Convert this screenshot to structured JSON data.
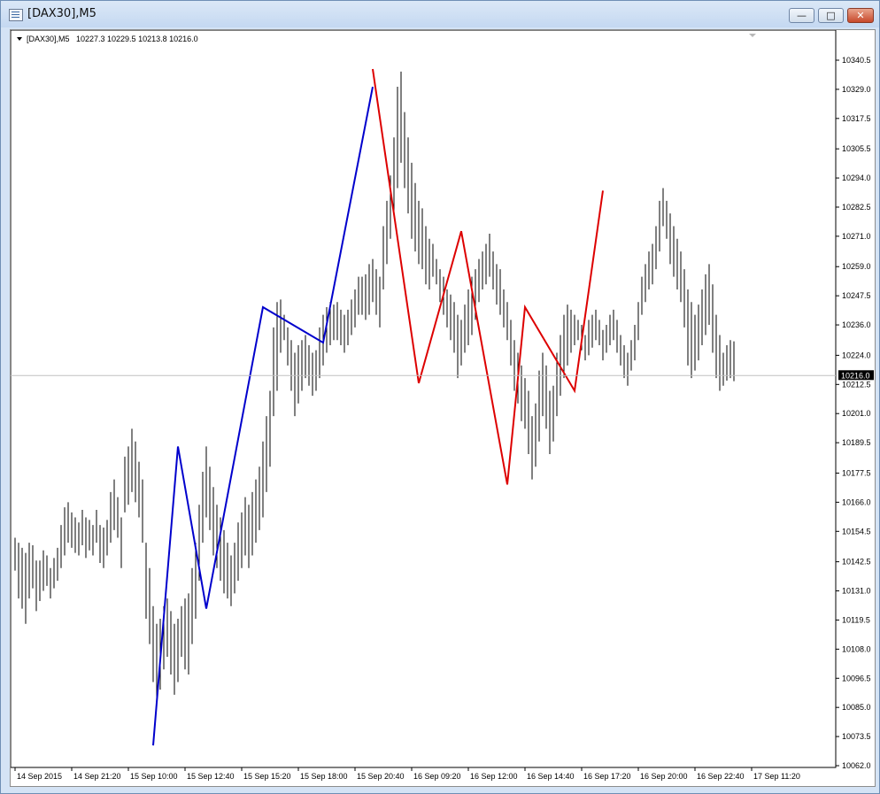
{
  "window": {
    "title": "[DAX30],M5",
    "buttons": {
      "minimize": "—",
      "maximize": "□",
      "close": "✕"
    },
    "icon": "chart-window-icon"
  },
  "chart_data": {
    "type": "bar",
    "symbol_header": "[DAX30],M5",
    "ohlc_header": "10227.3 10229.5 10213.8 10216.0",
    "current_price_label": "10216.0",
    "current_price": 10216.0,
    "ylim": [
      10062.0,
      10350.0
    ],
    "y_ticks": [
      "10340.5",
      "10329.0",
      "10317.5",
      "10305.5",
      "10294.0",
      "10282.5",
      "10271.0",
      "10259.0",
      "10247.5",
      "10236.0",
      "10224.0",
      "10212.5",
      "10201.0",
      "10189.5",
      "10177.5",
      "10166.0",
      "10154.5",
      "10142.5",
      "10131.0",
      "10119.5",
      "10108.0",
      "10096.5",
      "10085.0",
      "10073.5",
      "10062.0"
    ],
    "x_ticks": [
      "14 Sep 2015",
      "14 Sep 21:20",
      "15 Sep 10:00",
      "15 Sep 12:40",
      "15 Sep 15:20",
      "15 Sep 18:00",
      "15 Sep 20:40",
      "16 Sep 09:20",
      "16 Sep 12:00",
      "16 Sep 14:40",
      "16 Sep 17:20",
      "16 Sep 20:00",
      "16 Sep 22:40",
      "17 Sep 11:20"
    ],
    "x_tick_index": [
      0,
      16,
      32,
      48,
      64,
      80,
      96,
      112,
      128,
      144,
      160,
      176,
      192,
      208
    ],
    "bars": [
      [
        10139,
        10152
      ],
      [
        10128,
        10150
      ],
      [
        10124,
        10148
      ],
      [
        10118,
        10146
      ],
      [
        10128,
        10150
      ],
      [
        10132,
        10149
      ],
      [
        10123,
        10143
      ],
      [
        10127,
        10143
      ],
      [
        10131,
        10147
      ],
      [
        10133,
        10145
      ],
      [
        10128,
        10140
      ],
      [
        10132,
        10144
      ],
      [
        10135,
        10148
      ],
      [
        10140,
        10157
      ],
      [
        10145,
        10164
      ],
      [
        10150,
        10166
      ],
      [
        10148,
        10162
      ],
      [
        10146,
        10160
      ],
      [
        10145,
        10158
      ],
      [
        10149,
        10163
      ],
      [
        10144,
        10160
      ],
      [
        10147,
        10159
      ],
      [
        10145,
        10157
      ],
      [
        10150,
        10163
      ],
      [
        10142,
        10157
      ],
      [
        10140,
        10156
      ],
      [
        10145,
        10159
      ],
      [
        10150,
        10170
      ],
      [
        10155,
        10175
      ],
      [
        10152,
        10168
      ],
      [
        10140,
        10160
      ],
      [
        10162,
        10184
      ],
      [
        10165,
        10188
      ],
      [
        10170,
        10195
      ],
      [
        10166,
        10190
      ],
      [
        10160,
        10182
      ],
      [
        10150,
        10175
      ],
      [
        10120,
        10150
      ],
      [
        10110,
        10140
      ],
      [
        10095,
        10125
      ],
      [
        10088,
        10118
      ],
      [
        10092,
        10120
      ],
      [
        10100,
        10125
      ],
      [
        10105,
        10128
      ],
      [
        10098,
        10123
      ],
      [
        10090,
        10118
      ],
      [
        10095,
        10120
      ],
      [
        10105,
        10125
      ],
      [
        10100,
        10128
      ],
      [
        10098,
        10130
      ],
      [
        10110,
        10140
      ],
      [
        10120,
        10150
      ],
      [
        10135,
        10165
      ],
      [
        10150,
        10178
      ],
      [
        10160,
        10188
      ],
      [
        10155,
        10180
      ],
      [
        10145,
        10172
      ],
      [
        10140,
        10165
      ],
      [
        10135,
        10160
      ],
      [
        10130,
        10155
      ],
      [
        10128,
        10150
      ],
      [
        10125,
        10145
      ],
      [
        10130,
        10150
      ],
      [
        10135,
        10158
      ],
      [
        10140,
        10162
      ],
      [
        10145,
        10168
      ],
      [
        10140,
        10165
      ],
      [
        10145,
        10170
      ],
      [
        10150,
        10175
      ],
      [
        10155,
        10180
      ],
      [
        10160,
        10190
      ],
      [
        10170,
        10200
      ],
      [
        10180,
        10210
      ],
      [
        10200,
        10235
      ],
      [
        10210,
        10245
      ],
      [
        10225,
        10246
      ],
      [
        10230,
        10240
      ],
      [
        10220,
        10235
      ],
      [
        10210,
        10230
      ],
      [
        10200,
        10225
      ],
      [
        10205,
        10228
      ],
      [
        10210,
        10230
      ],
      [
        10215,
        10232
      ],
      [
        10212,
        10228
      ],
      [
        10208,
        10225
      ],
      [
        10210,
        10226
      ],
      [
        10215,
        10235
      ],
      [
        10220,
        10240
      ],
      [
        10225,
        10243
      ],
      [
        10228,
        10245
      ],
      [
        10230,
        10244
      ],
      [
        10230,
        10245
      ],
      [
        10228,
        10242
      ],
      [
        10225,
        10240
      ],
      [
        10228,
        10242
      ],
      [
        10232,
        10246
      ],
      [
        10235,
        10250
      ],
      [
        10240,
        10255
      ],
      [
        10240,
        10255
      ],
      [
        10238,
        10256
      ],
      [
        10240,
        10260
      ],
      [
        10245,
        10262
      ],
      [
        10240,
        10258
      ],
      [
        10235,
        10255
      ],
      [
        10250,
        10275
      ],
      [
        10260,
        10285
      ],
      [
        10270,
        10295
      ],
      [
        10280,
        10310
      ],
      [
        10290,
        10330
      ],
      [
        10300,
        10336
      ],
      [
        10290,
        10320
      ],
      [
        10280,
        10310
      ],
      [
        10270,
        10300
      ],
      [
        10265,
        10292
      ],
      [
        10260,
        10285
      ],
      [
        10258,
        10282
      ],
      [
        10252,
        10275
      ],
      [
        10250,
        10270
      ],
      [
        10255,
        10268
      ],
      [
        10252,
        10262
      ],
      [
        10245,
        10258
      ],
      [
        10240,
        10255
      ],
      [
        10235,
        10250
      ],
      [
        10230,
        10248
      ],
      [
        10225,
        10245
      ],
      [
        10215,
        10240
      ],
      [
        10220,
        10238
      ],
      [
        10225,
        10244
      ],
      [
        10228,
        10250
      ],
      [
        10232,
        10255
      ],
      [
        10238,
        10258
      ],
      [
        10245,
        10262
      ],
      [
        10250,
        10265
      ],
      [
        10252,
        10268
      ],
      [
        10255,
        10272
      ],
      [
        10250,
        10265
      ],
      [
        10244,
        10260
      ],
      [
        10240,
        10258
      ],
      [
        10235,
        10250
      ],
      [
        10230,
        10245
      ],
      [
        10220,
        10238
      ],
      [
        10210,
        10230
      ],
      [
        10205,
        10225
      ],
      [
        10198,
        10220
      ],
      [
        10195,
        10215
      ],
      [
        10185,
        10210
      ],
      [
        10175,
        10200
      ],
      [
        10180,
        10205
      ],
      [
        10190,
        10218
      ],
      [
        10200,
        10225
      ],
      [
        10195,
        10220
      ],
      [
        10185,
        10210
      ],
      [
        10190,
        10212
      ],
      [
        10200,
        10225
      ],
      [
        10208,
        10232
      ],
      [
        10215,
        10240
      ],
      [
        10220,
        10244
      ],
      [
        10225,
        10242
      ],
      [
        10228,
        10240
      ],
      [
        10230,
        10238
      ],
      [
        10226,
        10236
      ],
      [
        10222,
        10232
      ],
      [
        10224,
        10238
      ],
      [
        10227,
        10240
      ],
      [
        10230,
        10242
      ],
      [
        10228,
        10238
      ],
      [
        10222,
        10234
      ],
      [
        10225,
        10236
      ],
      [
        10228,
        10240
      ],
      [
        10230,
        10242
      ],
      [
        10225,
        10238
      ],
      [
        10220,
        10232
      ],
      [
        10215,
        10228
      ],
      [
        10212,
        10225
      ],
      [
        10218,
        10230
      ],
      [
        10222,
        10236
      ],
      [
        10230,
        10245
      ],
      [
        10240,
        10255
      ],
      [
        10245,
        10260
      ],
      [
        10250,
        10265
      ],
      [
        10252,
        10268
      ],
      [
        10258,
        10275
      ],
      [
        10265,
        10285
      ],
      [
        10275,
        10290
      ],
      [
        10270,
        10285
      ],
      [
        10260,
        10280
      ],
      [
        10255,
        10275
      ],
      [
        10250,
        10270
      ],
      [
        10245,
        10265
      ],
      [
        10235,
        10258
      ],
      [
        10220,
        10250
      ],
      [
        10215,
        10245
      ],
      [
        10218,
        10240
      ],
      [
        10222,
        10244
      ],
      [
        10228,
        10250
      ],
      [
        10232,
        10256
      ],
      [
        10236,
        10260
      ],
      [
        10225,
        10252
      ],
      [
        10215,
        10240
      ],
      [
        10210,
        10232
      ],
      [
        10212,
        10225
      ],
      [
        10214,
        10228
      ],
      [
        10215,
        10230
      ],
      [
        10213.8,
        10229.5
      ]
    ],
    "zigzag_series": [
      {
        "color": "#0000cc",
        "points": [
          [
            39,
            10070
          ],
          [
            46,
            10188
          ],
          [
            54,
            10124
          ],
          [
            70,
            10243
          ],
          [
            87,
            10229
          ],
          [
            101,
            10330
          ]
        ]
      },
      {
        "color": "#dd0000",
        "points": [
          [
            101,
            10337
          ],
          [
            114,
            10213
          ],
          [
            126,
            10273
          ],
          [
            139,
            10173
          ],
          [
            144,
            10243
          ],
          [
            158,
            10210
          ],
          [
            166,
            10289
          ]
        ]
      }
    ],
    "colors": {
      "bars": "#000000",
      "price_line": "#c0c0c0",
      "price_label_bg": "#000000"
    }
  }
}
